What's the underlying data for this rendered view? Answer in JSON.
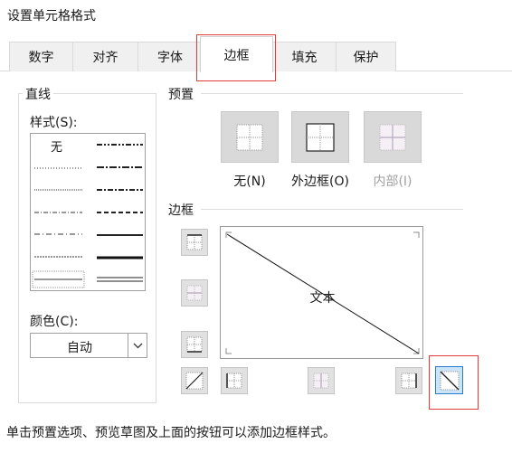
{
  "dialog": {
    "title": "设置单元格格式"
  },
  "tabs": [
    {
      "label": "数字"
    },
    {
      "label": "对齐"
    },
    {
      "label": "字体"
    },
    {
      "label": "边框",
      "active": true
    },
    {
      "label": "填充"
    },
    {
      "label": "保护"
    }
  ],
  "line_group": {
    "title": "直线",
    "style_label": "样式(S):",
    "none_label": "无",
    "color_label": "颜色(C):",
    "color_value": "自动"
  },
  "presets": {
    "title": "预置",
    "items": [
      {
        "label": "无(N)",
        "enabled": true
      },
      {
        "label": "外边框(O)",
        "enabled": true
      },
      {
        "label": "内部(I)",
        "enabled": false
      }
    ]
  },
  "border": {
    "title": "边框",
    "preview_text": "文本",
    "diagonal_down_active": true
  },
  "footer": {
    "hint": "单击预置选项、预览草图及上面的按钮可以添加边框样式。"
  },
  "colors": {
    "highlight": "#e03a3a",
    "button_bg": "#d9d9d9",
    "selected_bg": "#cce4f7"
  }
}
